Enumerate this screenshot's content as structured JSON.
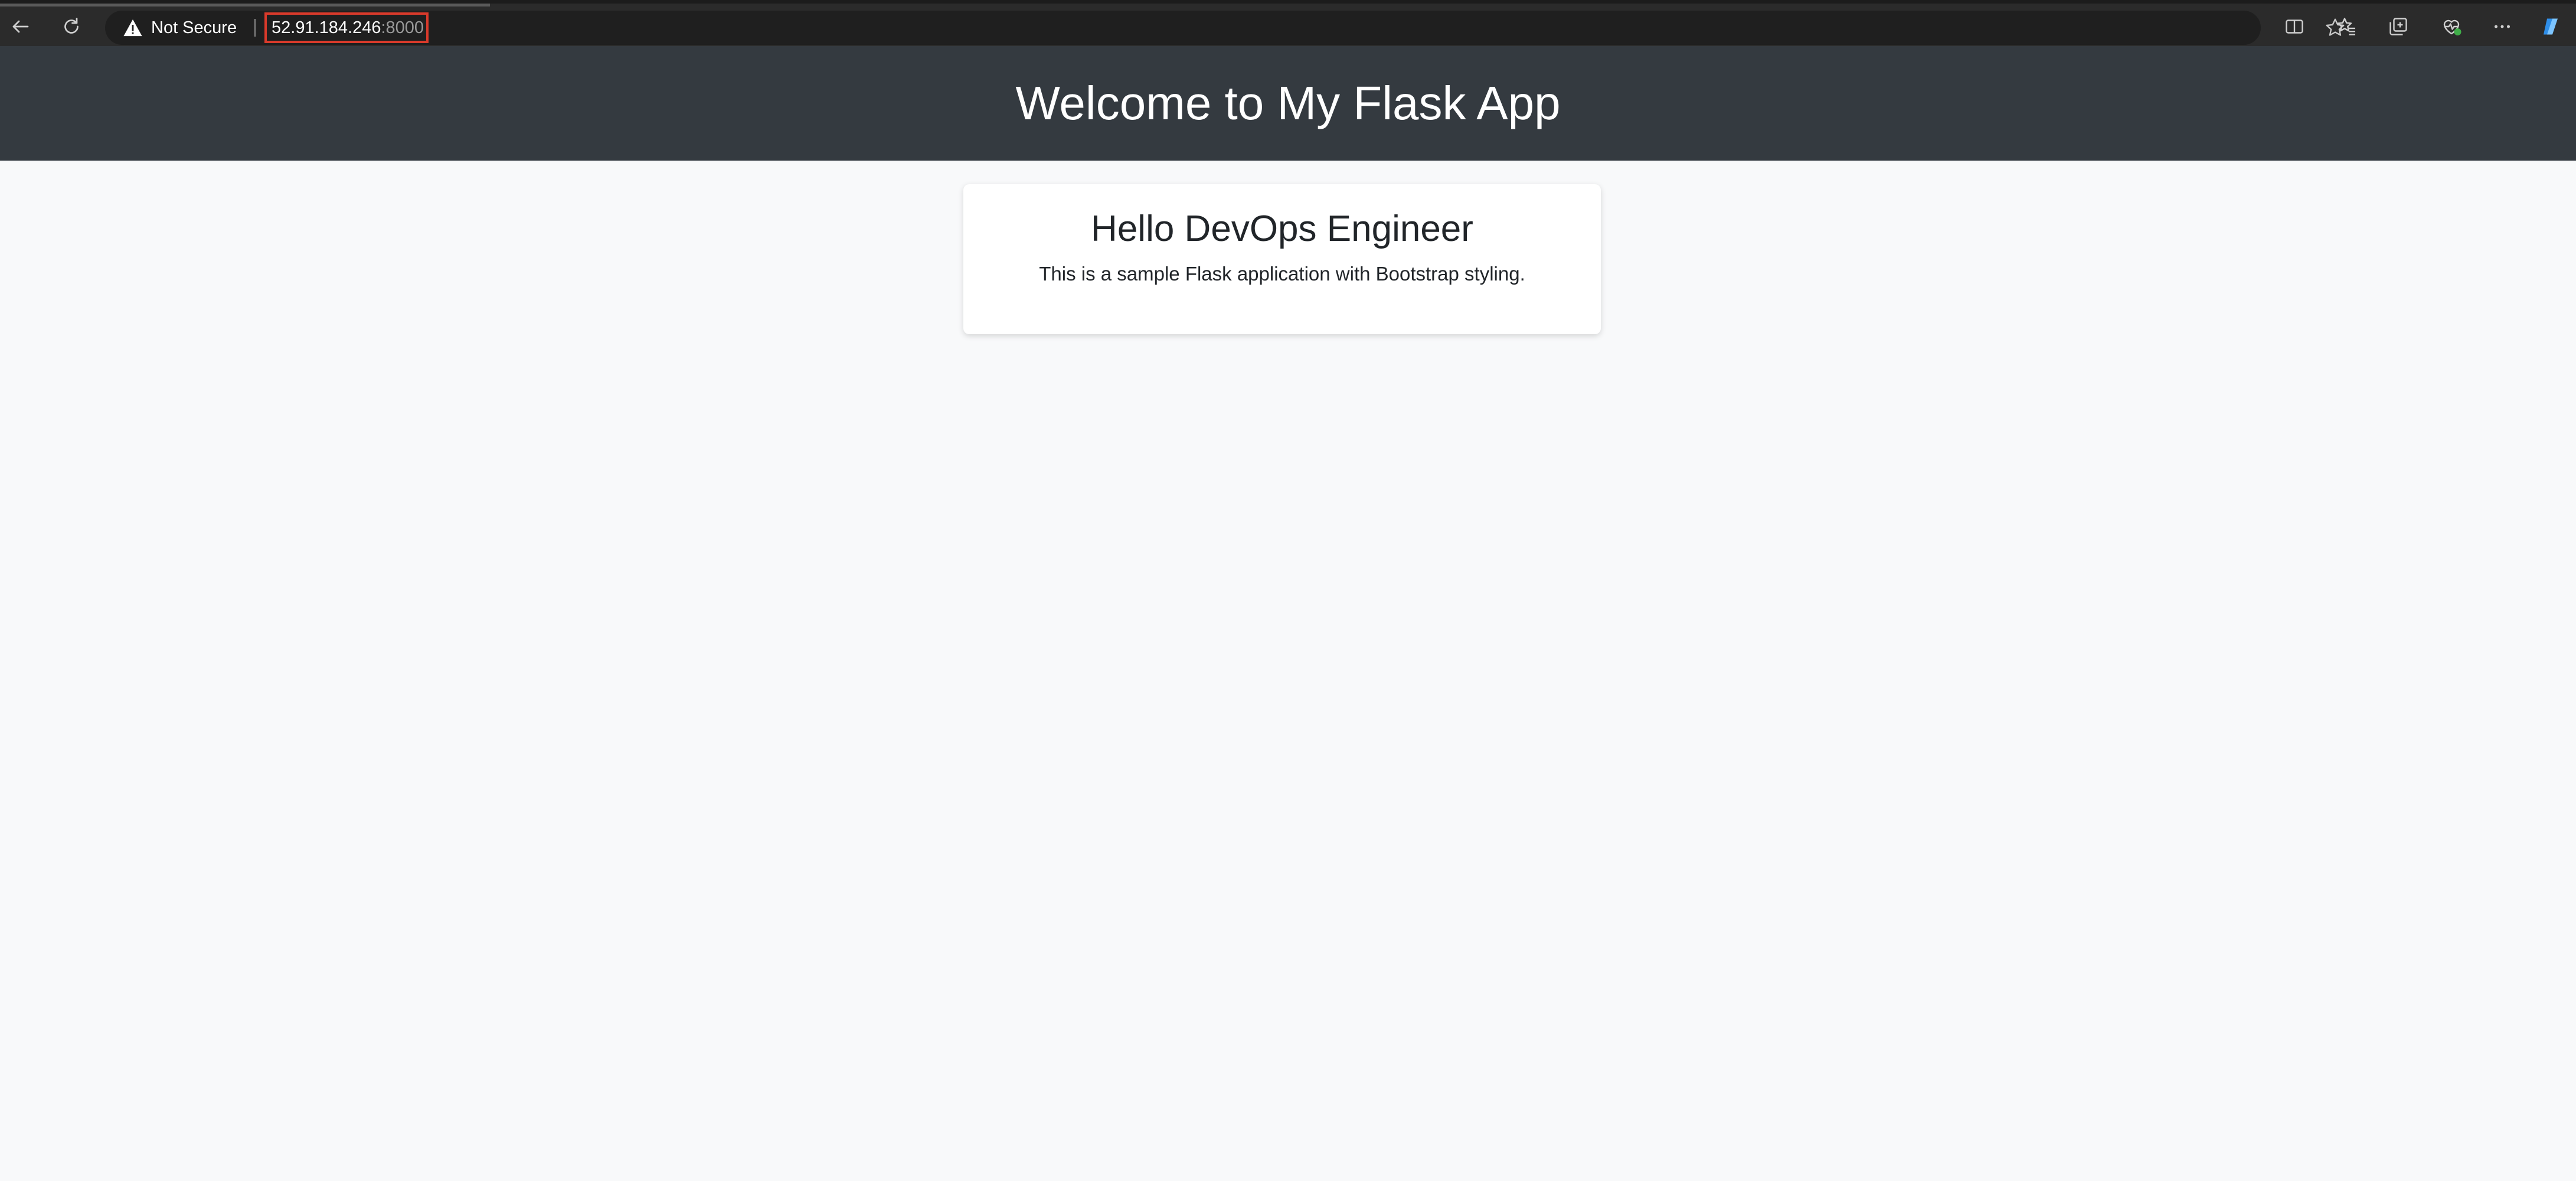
{
  "browser": {
    "security_label": "Not Secure",
    "url_host": "52.91.184.246",
    "url_port": ":8000",
    "icons": {
      "back": "arrow-left-icon",
      "reload": "reload-icon",
      "warning": "warning-triangle-icon",
      "favorite": "star-icon",
      "split_screen": "split-screen-icon",
      "favorites": "favorites-icon",
      "collections": "collections-icon",
      "browser_essentials": "heart-pulse-icon",
      "more": "ellipsis-icon",
      "copilot": "copilot-icon"
    },
    "url_highlight_color": "#d93a2b"
  },
  "header": {
    "title": "Welcome to My Flask App",
    "background": "#343a40"
  },
  "card": {
    "heading": "Hello DevOps Engineer",
    "text": "This is a sample Flask application with Bootstrap styling."
  }
}
